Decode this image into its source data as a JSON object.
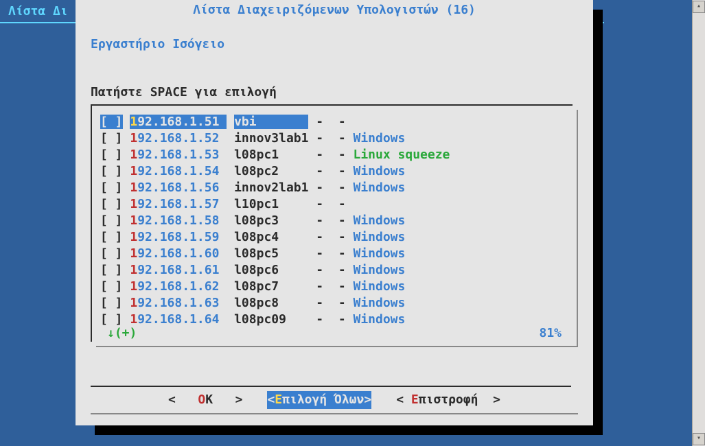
{
  "background": {
    "title_fragment": "Λίστα Δι"
  },
  "dialog": {
    "title": "Λίστα Διαχειριζόμενων Υπολογιστών (16)",
    "subtitle": "Εργαστήριο Ισόγειο",
    "hint": "Πατήστε SPACE για επιλογή",
    "more_indicator": "↓(+)",
    "scroll_pct": "81%"
  },
  "buttons": {
    "ok": {
      "left": "<   ",
      "hot": "O",
      "rest": "K",
      "right": "   >"
    },
    "selectall": {
      "left": "<",
      "hot": "Ε",
      "rest": "πιλογή Όλων",
      "right": ">"
    },
    "back": {
      "left": "< ",
      "hot": "Ε",
      "rest": "πιστροφή",
      "right": "  >"
    }
  },
  "hosts": [
    {
      "selected": true,
      "ip_first": "1",
      "ip_rest": "92.168.1.51",
      "host": "vbi",
      "os": "",
      "os_kind": ""
    },
    {
      "selected": false,
      "ip_first": "1",
      "ip_rest": "92.168.1.52",
      "host": "innov3lab1",
      "os": "Windows",
      "os_kind": "win"
    },
    {
      "selected": false,
      "ip_first": "1",
      "ip_rest": "92.168.1.53",
      "host": "l08pc1",
      "os": "Linux squeeze",
      "os_kind": "linux"
    },
    {
      "selected": false,
      "ip_first": "1",
      "ip_rest": "92.168.1.54",
      "host": "l08pc2",
      "os": "Windows",
      "os_kind": "win"
    },
    {
      "selected": false,
      "ip_first": "1",
      "ip_rest": "92.168.1.56",
      "host": "innov2lab1",
      "os": "Windows",
      "os_kind": "win"
    },
    {
      "selected": false,
      "ip_first": "1",
      "ip_rest": "92.168.1.57",
      "host": "l10pc1",
      "os": "",
      "os_kind": ""
    },
    {
      "selected": false,
      "ip_first": "1",
      "ip_rest": "92.168.1.58",
      "host": "l08pc3",
      "os": "Windows",
      "os_kind": "win"
    },
    {
      "selected": false,
      "ip_first": "1",
      "ip_rest": "92.168.1.59",
      "host": "l08pc4",
      "os": "Windows",
      "os_kind": "win"
    },
    {
      "selected": false,
      "ip_first": "1",
      "ip_rest": "92.168.1.60",
      "host": "l08pc5",
      "os": "Windows",
      "os_kind": "win"
    },
    {
      "selected": false,
      "ip_first": "1",
      "ip_rest": "92.168.1.61",
      "host": "l08pc6",
      "os": "Windows",
      "os_kind": "win"
    },
    {
      "selected": false,
      "ip_first": "1",
      "ip_rest": "92.168.1.62",
      "host": "l08pc7",
      "os": "Windows",
      "os_kind": "win"
    },
    {
      "selected": false,
      "ip_first": "1",
      "ip_rest": "92.168.1.63",
      "host": "l08pc8",
      "os": "Windows",
      "os_kind": "win"
    },
    {
      "selected": false,
      "ip_first": "1",
      "ip_rest": "92.168.1.64",
      "host": "l08pc09",
      "os": "Windows",
      "os_kind": "win"
    }
  ]
}
